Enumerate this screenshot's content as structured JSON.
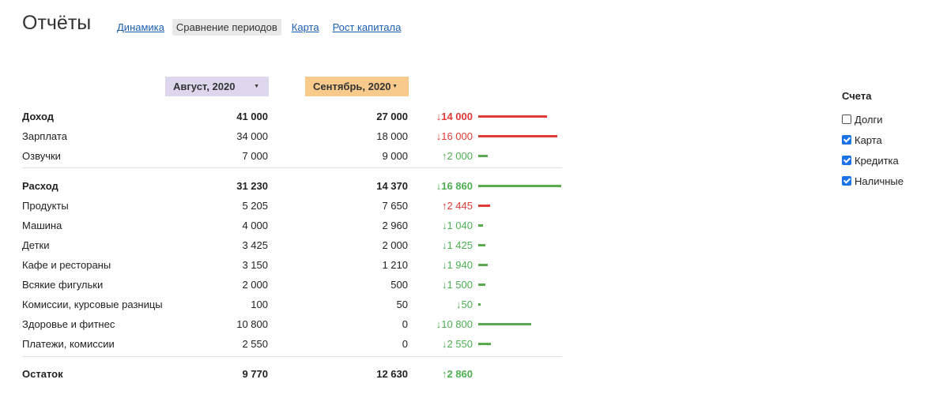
{
  "title": "Отчёты",
  "nav": {
    "tabs": [
      "Динамика",
      "Сравнение периодов",
      "Карта",
      "Рост капитала"
    ],
    "active_index": 1
  },
  "periods": {
    "first": "Август, 2020",
    "second": "Сентябрь, 2020"
  },
  "rows": {
    "income": {
      "label": "Доход",
      "v1": "41 000",
      "v2": "27 000",
      "diff": "↓14 000",
      "dir": "red",
      "bar_value": 14000
    },
    "salary": {
      "label": "Зарплата",
      "v1": "34 000",
      "v2": "18 000",
      "diff": "↓16 000",
      "dir": "red",
      "bar_value": 16000
    },
    "voice": {
      "label": "Озвучки",
      "v1": "7 000",
      "v2": "9 000",
      "diff": "↑2 000",
      "dir": "green",
      "bar_value": 2000
    },
    "expense": {
      "label": "Расход",
      "v1": "31 230",
      "v2": "14 370",
      "diff": "↓16 860",
      "dir": "green",
      "bar_value": 16860
    },
    "products": {
      "label": "Продукты",
      "v1": "5 205",
      "v2": "7 650",
      "diff": "↑2 445",
      "dir": "red",
      "bar_value": 2445
    },
    "car": {
      "label": "Машина",
      "v1": "4 000",
      "v2": "2 960",
      "diff": "↓1 040",
      "dir": "green",
      "bar_value": 1040
    },
    "kids": {
      "label": "Детки",
      "v1": "3 425",
      "v2": "2 000",
      "diff": "↓1 425",
      "dir": "green",
      "bar_value": 1425
    },
    "cafe": {
      "label": "Кафе и рестораны",
      "v1": "3 150",
      "v2": "1 210",
      "diff": "↓1 940",
      "dir": "green",
      "bar_value": 1940
    },
    "misc": {
      "label": "Всякие фигульки",
      "v1": "2 000",
      "v2": "500",
      "diff": "↓1 500",
      "dir": "green",
      "bar_value": 1500
    },
    "fees": {
      "label": "Комиссии, курсовые разницы",
      "v1": "100",
      "v2": "50",
      "diff": "↓50",
      "dir": "green",
      "bar_value": 50
    },
    "health": {
      "label": "Здоровье и фитнес",
      "v1": "10 800",
      "v2": "0",
      "diff": "↓10 800",
      "dir": "green",
      "bar_value": 10800
    },
    "payments": {
      "label": "Платежи, комиссии",
      "v1": "2 550",
      "v2": "0",
      "diff": "↓2 550",
      "dir": "green",
      "bar_value": 2550
    },
    "balance": {
      "label": "Остаток",
      "v1": "9 770",
      "v2": "12 630",
      "diff": "↑2 860",
      "dir": "green",
      "bar_value": 0
    }
  },
  "accounts": {
    "heading": "Счета",
    "items": [
      {
        "label": "Долги",
        "checked": false
      },
      {
        "label": "Карта",
        "checked": true
      },
      {
        "label": "Кредитка",
        "checked": true
      },
      {
        "label": "Наличные",
        "checked": true
      }
    ]
  },
  "colors": {
    "decrease_red": "#e03b36",
    "increase_green": "#4caf50",
    "first_period_bg": "#dcd7ed",
    "second_period_bg": "#f8cb8d",
    "link": "#1a5fb4"
  }
}
